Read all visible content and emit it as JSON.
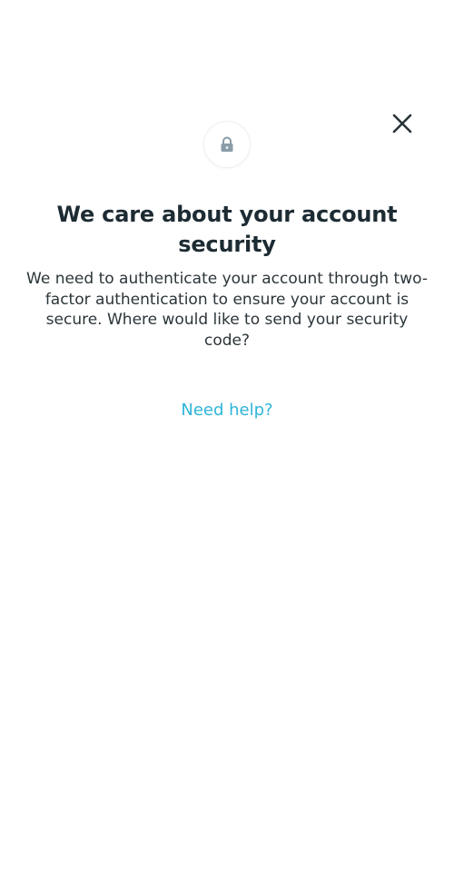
{
  "header": {
    "close_icon": "close-icon"
  },
  "badge": {
    "icon": "lock-icon",
    "icon_color": "#8a9ca8"
  },
  "content": {
    "title": "We care about your account security",
    "description": "We need to authenticate your account through two-factor authentication to ensure your account is secure. Where would like to send your security code?",
    "help_link": "Need help?"
  },
  "colors": {
    "background": "#ffffff",
    "title_text": "#1d2b33",
    "body_text": "#2b3539",
    "link": "#2eb5d9",
    "close_icon": "#2b3539"
  }
}
